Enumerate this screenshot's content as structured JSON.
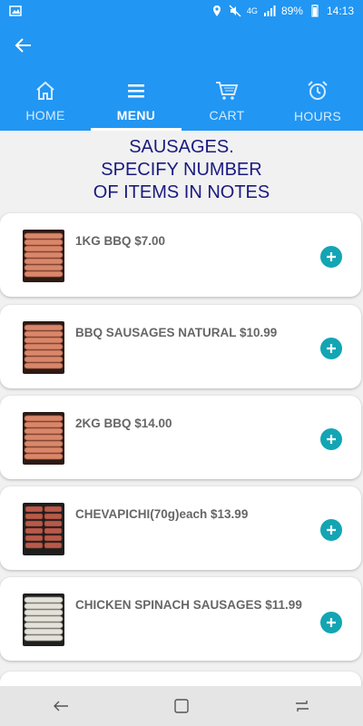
{
  "status_bar": {
    "network": "4G",
    "battery": "89%",
    "time": "14:13"
  },
  "header": {
    "back_icon": "arrow-left-icon",
    "tabs": [
      {
        "label": "HOME",
        "icon": "home-icon",
        "active": false
      },
      {
        "label": "MENU",
        "icon": "menu-icon",
        "active": true
      },
      {
        "label": "CART",
        "icon": "cart-icon",
        "active": false
      },
      {
        "label": "HOURS",
        "icon": "alarm-clock-icon",
        "active": false
      }
    ]
  },
  "page": {
    "title_line1": "SAUSAGES.",
    "title_line2": "SPECIFY NUMBER",
    "title_line3": "OF ITEMS IN NOTES"
  },
  "items": [
    {
      "name": "1KG BBQ $7.00"
    },
    {
      "name": "BBQ SAUSAGES NATURAL $10.99"
    },
    {
      "name": "2KG BBQ $14.00"
    },
    {
      "name": "CHEVAPICHI(70g)each $13.99"
    },
    {
      "name": "CHICKEN SPINACH SAUSAGES $11.99"
    }
  ],
  "colors": {
    "primary": "#2196f3",
    "title": "#1a1a80",
    "accent": "#13a5b4"
  }
}
